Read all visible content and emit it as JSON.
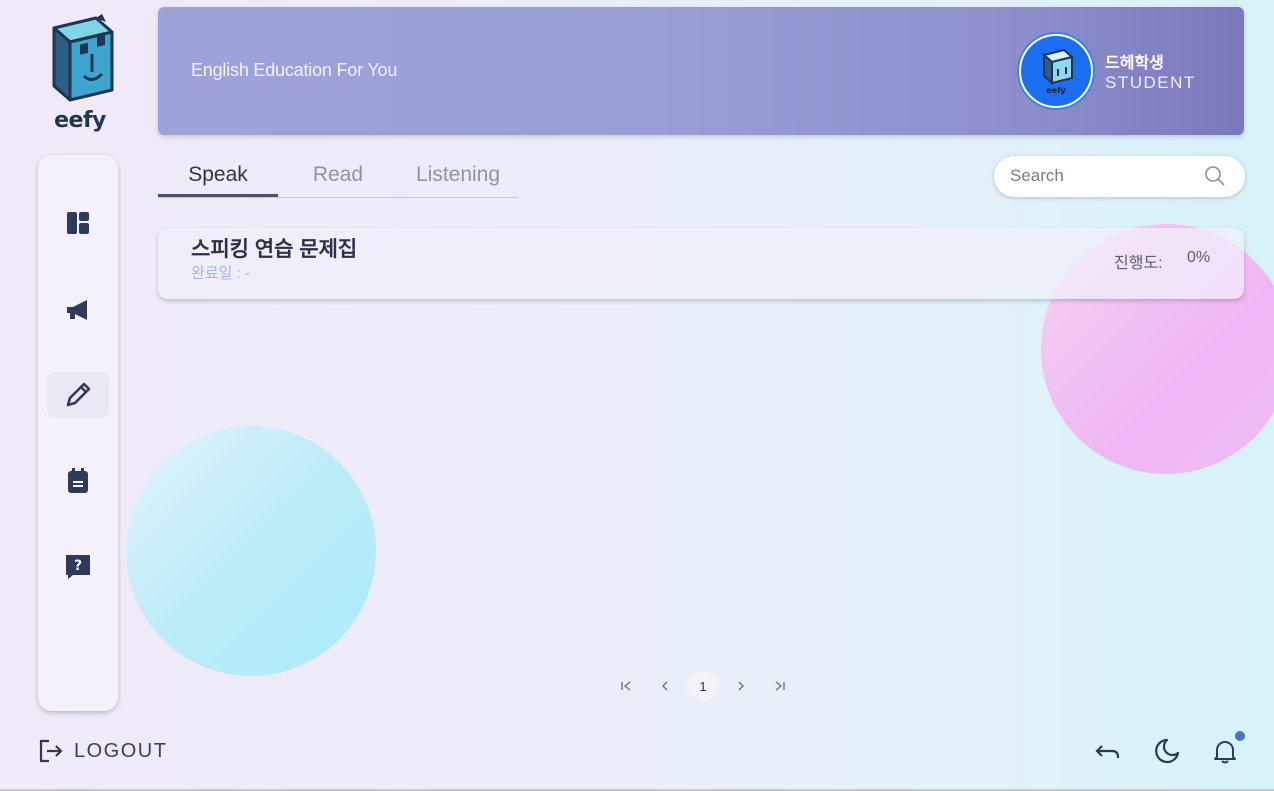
{
  "app": {
    "logo_text": "eefy",
    "tagline": "English Education For You"
  },
  "user": {
    "name": "드헤학생",
    "role": "STUDENT",
    "avatar_icon": "eefy-book-logo"
  },
  "sidebar": {
    "items": [
      {
        "icon": "dashboard-icon",
        "active": false
      },
      {
        "icon": "megaphone-icon",
        "active": false
      },
      {
        "icon": "pencil-icon",
        "active": true
      },
      {
        "icon": "notepad-icon",
        "active": false
      },
      {
        "icon": "help-question-icon",
        "active": false
      }
    ]
  },
  "tabs": [
    {
      "label": "Speak",
      "active": true
    },
    {
      "label": "Read",
      "active": false
    },
    {
      "label": "Listening",
      "active": false
    }
  ],
  "search": {
    "placeholder": "Search",
    "value": ""
  },
  "cards": [
    {
      "title": "스피킹 연습 문제집",
      "date_label": "완료일 : -",
      "progress_label": "진행도:",
      "progress_value": "0%"
    }
  ],
  "pagination": {
    "first": "|<",
    "prev": "<",
    "current": "1",
    "next": ">",
    "last": ">|"
  },
  "footer": {
    "logout_label": "LOGOUT"
  },
  "colors": {
    "header_start": "#9fa2d8",
    "header_end": "#7b78bd",
    "avatar_ring": "#1c6ef0",
    "notification_dot": "#4a6fd0",
    "icon_dark": "#2f3a58"
  }
}
